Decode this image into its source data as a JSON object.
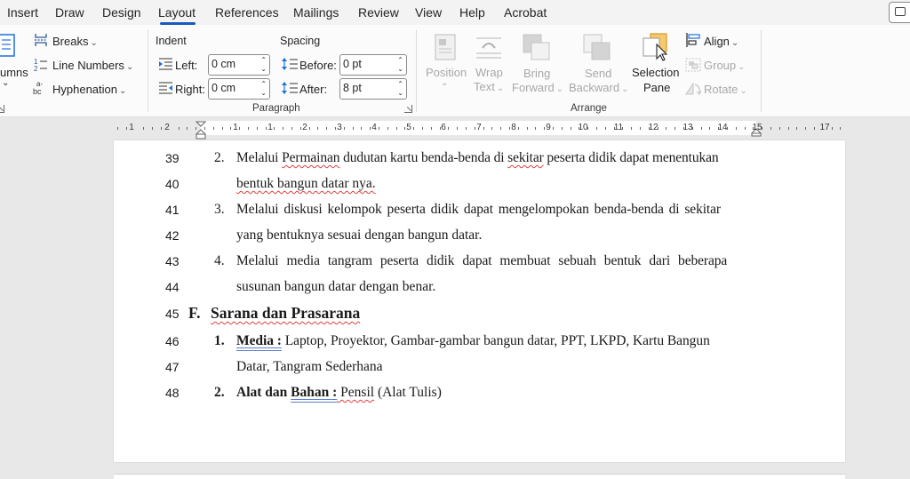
{
  "menu": {
    "tabs": [
      "Insert",
      "Draw",
      "Design",
      "Layout",
      "References",
      "Mailings",
      "Review",
      "View",
      "Help",
      "Acrobat"
    ],
    "active": "Layout"
  },
  "ribbon": {
    "columns_label": "umns",
    "breaks_label": "Breaks",
    "line_numbers_label": "Line Numbers",
    "hyphenation_label": "Hyphenation",
    "indent_title": "Indent",
    "spacing_title": "Spacing",
    "left_label": "Left:",
    "right_label": "Right:",
    "before_label": "Before:",
    "after_label": "After:",
    "indent_left_value": "0 cm",
    "indent_right_value": "0 cm",
    "spacing_before_value": "0 pt",
    "spacing_after_value": "8 pt",
    "paragraph_group": "Paragraph",
    "position_label_1": "Position",
    "wrap_label_1": "Wrap",
    "wrap_label_2": "Text",
    "bring_label_1": "Bring",
    "bring_label_2": "Forward",
    "send_label_1": "Send",
    "send_label_2": "Backward",
    "selection_label_1": "Selection",
    "selection_label_2": "Pane",
    "align_label": "Align",
    "group_label": "Group",
    "rotate_label": "Rotate",
    "arrange_group": "Arrange"
  },
  "ruler": {
    "numbers": [
      "1",
      "2",
      "1",
      "1",
      "2",
      "3",
      "4",
      "5",
      "6",
      "7",
      "8",
      "9",
      "10",
      "11",
      "12",
      "13",
      "14",
      "15",
      "17"
    ]
  },
  "document": {
    "lines": [
      {
        "num": "39",
        "marker": "2.",
        "text_parts": [
          "Melalui ",
          "Permainan",
          " dudutan kartu benda-benda di ",
          "sekitar",
          " peserta didik dapat menentukan"
        ]
      },
      {
        "num": "40",
        "text": "bentuk bangun datar nya."
      },
      {
        "num": "41",
        "marker": "3.",
        "text": "Melalui diskusi kelompok peserta didik dapat mengelompokan benda-benda di sekitar"
      },
      {
        "num": "42",
        "text": "yang bentuknya sesuai dengan bangun datar."
      },
      {
        "num": "43",
        "marker": "4.",
        "text": "Melalui media tangram peserta didik dapat membuat sebuah bentuk dari beberapa"
      },
      {
        "num": "44",
        "text": "susunan bangun datar dengan benar."
      },
      {
        "num": "45",
        "marker": "F.",
        "text": "Sarana dan Prasarana"
      },
      {
        "num": "46",
        "marker": "1.",
        "label": "Media :",
        "text": " Laptop, Proyektor, Gambar-gambar bangun datar, PPT, LKPD, Kartu Bangun"
      },
      {
        "num": "47",
        "text": "Datar, Tangram Sederhana"
      },
      {
        "num": "48",
        "marker": "2.",
        "label_a": "Alat dan ",
        "label_b": "Bahan :",
        "text_a": " Pensil",
        "text_b": " (Alat Tulis)"
      }
    ]
  }
}
